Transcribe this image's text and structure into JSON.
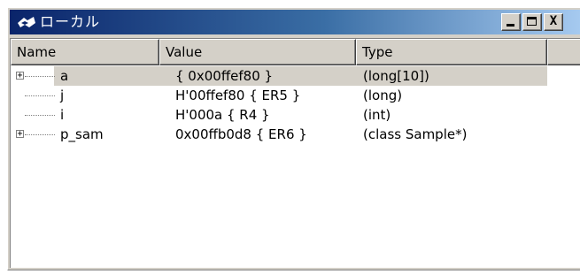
{
  "window": {
    "title": "ローカル"
  },
  "title_buttons": {
    "close_glyph": "X"
  },
  "columns": [
    "Name",
    "Value",
    "Type"
  ],
  "rows": [
    {
      "name": "a",
      "value": " { 0x00ffef80 }",
      "type": "(long[10])",
      "expandable": true,
      "selected": true
    },
    {
      "name": "j",
      "value": "H'00ffef80 { ER5 }",
      "type": "(long)",
      "expandable": false,
      "selected": false
    },
    {
      "name": "i",
      "value": "H'000a { R4 }",
      "type": "(int)",
      "expandable": false,
      "selected": false
    },
    {
      "name": "p_sam",
      "value": "0x00ffb0d8 { ER6 }",
      "type": "(class Sample*)",
      "expandable": true,
      "selected": false
    }
  ],
  "colors": {
    "title_start": "#0a246a",
    "title_end": "#a6caf0",
    "face": "#d4d0c8"
  },
  "icons": {
    "title": "locals-window-icon",
    "expand": "plus-box-icon"
  }
}
